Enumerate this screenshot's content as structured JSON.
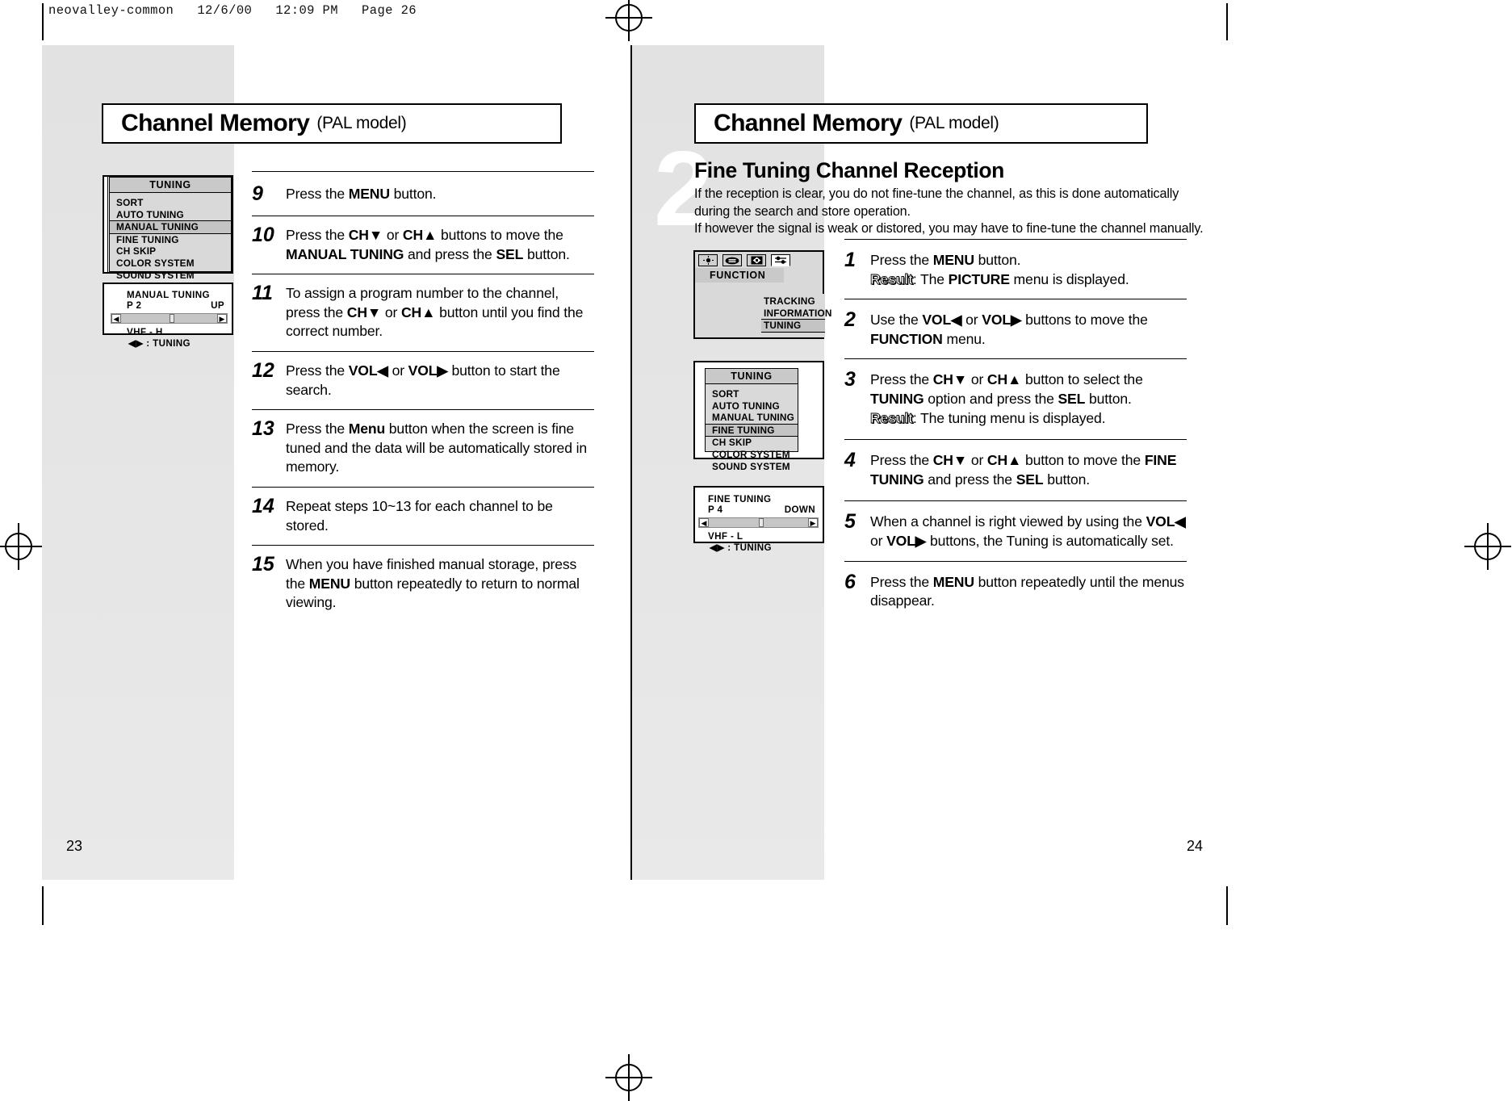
{
  "slug": "neovalley-common   12/6/00   12:09 PM   Page 26",
  "left_page": {
    "title_main": "Channel Memory",
    "title_sub": "(PAL model)",
    "folio": "23",
    "tuning_menu": {
      "title": "TUNING",
      "items": [
        {
          "label": "SORT",
          "selected": false
        },
        {
          "label": "AUTO  TUNING",
          "selected": false
        },
        {
          "label": "MANUAL  TUNING",
          "selected": true
        },
        {
          "label": "FINE TUNING",
          "selected": false
        },
        {
          "label": "CH  SKIP",
          "selected": false
        },
        {
          "label": "COLOR  SYSTEM",
          "selected": false
        },
        {
          "label": "SOUND SYSTEM",
          "selected": false
        }
      ]
    },
    "manual_tuning_box": {
      "title": "MANUAL   TUNING",
      "program": "P  2",
      "direction": "UP",
      "band": "VHF - H",
      "hint": "◀▶ : TUNING"
    },
    "steps": [
      {
        "num": "9",
        "html": "Press the <b>MENU</b> button."
      },
      {
        "num": "10",
        "html": "Press the <b>CH▼</b> or <b>CH▲</b> buttons to move the <b>MANUAL TUNING</b> and press the <b>SEL</b> button."
      },
      {
        "num": "11",
        "html": "To assign a program number to the channel, press the <b>CH▼</b> or <b>CH▲</b> button until you find the correct number."
      },
      {
        "num": "12",
        "html": "Press the <b>VOL◀</b> or <b>VOL▶</b> button to start the search."
      },
      {
        "num": "13",
        "html": "Press the <b>Menu</b> button when the screen is fine tuned and the data will be automatically stored in memory."
      },
      {
        "num": "14",
        "html": "Repeat steps 10~13 for each channel to be stored."
      },
      {
        "num": "15",
        "html": "When you have finished manual storage, press the <b>MENU</b> button repeatedly to return to normal viewing."
      }
    ]
  },
  "right_page": {
    "title_main": "Channel Memory",
    "title_sub": "(PAL model)",
    "folio": "24",
    "watermark": "2",
    "section_heading": "Fine Tuning Channel Reception",
    "section_body": "If the reception is clear, you do not fine-tune the channel, as this is done automatically during the search and store operation.\nIf however the signal is weak or distored, you may have to fine-tune the channel manually.",
    "function_menu": {
      "title": "FUNCTION",
      "icons": [
        "picture-icon",
        "sound-icon",
        "screen-icon",
        "function-icon"
      ],
      "submenu": [
        {
          "label": "TRACKING",
          "selected": false
        },
        {
          "label": "INFORMATION",
          "selected": false
        },
        {
          "label": "TUNING",
          "selected": true
        }
      ]
    },
    "tuning_menu": {
      "title": "TUNING",
      "items": [
        {
          "label": "SORT",
          "selected": false
        },
        {
          "label": "AUTO  TUNING",
          "selected": false
        },
        {
          "label": "MANUAL  TUNING",
          "selected": false
        },
        {
          "label": "FINE TUNING",
          "selected": true
        },
        {
          "label": "CH  SKIP",
          "selected": false
        },
        {
          "label": "COLOR  SYSTEM",
          "selected": false
        },
        {
          "label": "SOUND SYSTEM",
          "selected": false
        }
      ]
    },
    "fine_tuning_box": {
      "title": "FINE TUNING",
      "program": "P    4",
      "direction": "DOWN",
      "band": "VHF - L",
      "hint": "◀▶ : TUNING"
    },
    "steps": [
      {
        "num": "1",
        "html": "Press the <b>MENU</b> button.<br><span class=\"res\">Result</span>: The <b>PICTURE</b> menu is displayed."
      },
      {
        "num": "2",
        "html": "Use the <b>VOL◀</b> or <b>VOL▶</b> buttons to move the <b>FUNCTION</b> menu."
      },
      {
        "num": "3",
        "html": "Press the <b>CH▼</b> or <b>CH▲</b> button to select the <b>TUNING</b> option and press the <b>SEL</b> button.<br><span class=\"res\">Result</span>: The tuning menu is displayed."
      },
      {
        "num": "4",
        "html": "Press the <b>CH▼</b> or <b>CH▲</b> button to move the <b>FINE TUNING</b>  and press the <b>SEL</b> button."
      },
      {
        "num": "5",
        "html": "When a channel is right viewed by using the <b>VOL◀</b> or <b>VOL▶</b> buttons, the Tuning is automatically set."
      },
      {
        "num": "6",
        "html": "Press the <b>MENU</b> button repeatedly until the menus disappear."
      }
    ]
  }
}
